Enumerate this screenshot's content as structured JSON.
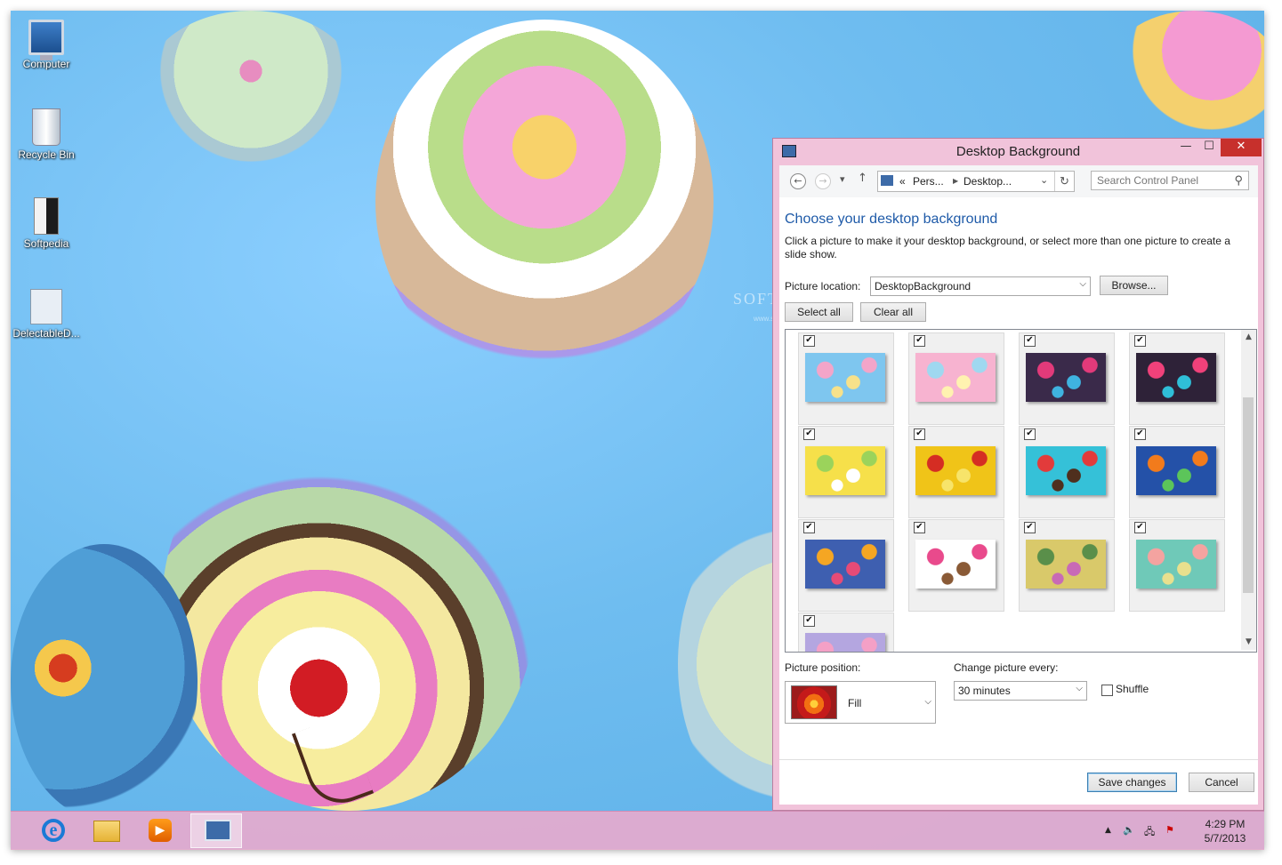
{
  "desktop": {
    "icons": [
      {
        "label": "Computer"
      },
      {
        "label": "Recycle Bin"
      },
      {
        "label": "Softpedia"
      },
      {
        "label": "DelectableD..."
      }
    ],
    "watermark": "SOFTPEDIA",
    "watermark_sub": "www.softpedia.com"
  },
  "window": {
    "title": "Desktop Background",
    "controls": {
      "minimize": "—",
      "maximize": "☐",
      "close": "✕"
    },
    "nav": {
      "breadcrumb_prefix": "«",
      "crumb1": "Pers...",
      "crumb2": "Desktop...",
      "search_placeholder": "Search Control Panel"
    },
    "heading": "Choose your desktop background",
    "description": "Click a picture to make it your desktop background, or select more than one picture to create a slide show.",
    "picture_location_label": "Picture location:",
    "picture_location_value": "DesktopBackground",
    "browse_label": "Browse...",
    "select_all_label": "Select all",
    "clear_all_label": "Clear all",
    "thumbnails": [
      {
        "checked": true,
        "colors": [
          "#7ec6ef",
          "#f3a5c9",
          "#f7e18a"
        ]
      },
      {
        "checked": true,
        "colors": [
          "#f7b3d0",
          "#9fd8f0",
          "#fff2b0"
        ]
      },
      {
        "checked": true,
        "colors": [
          "#3a2a4a",
          "#e23a7a",
          "#3fb3e0"
        ]
      },
      {
        "checked": true,
        "colors": [
          "#2e2238",
          "#f0417a",
          "#2fbfd8"
        ]
      },
      {
        "checked": true,
        "colors": [
          "#f6e04a",
          "#9bd35b",
          "#ffffff"
        ]
      },
      {
        "checked": true,
        "colors": [
          "#f0c418",
          "#d52d23",
          "#f7e46a"
        ]
      },
      {
        "checked": true,
        "colors": [
          "#35c1d8",
          "#e23b3b",
          "#4f2f1e"
        ]
      },
      {
        "checked": true,
        "colors": [
          "#2451a8",
          "#f27b1c",
          "#5cc55a"
        ]
      },
      {
        "checked": true,
        "colors": [
          "#3e5fb0",
          "#f5a623",
          "#e64b77"
        ]
      },
      {
        "checked": true,
        "colors": [
          "#ffffff",
          "#e94a8c",
          "#8a5a36"
        ]
      },
      {
        "checked": true,
        "colors": [
          "#d9c96a",
          "#5a8f4a",
          "#c86ab6"
        ]
      },
      {
        "checked": true,
        "colors": [
          "#6fc9b8",
          "#f4a3a0",
          "#e8e08e"
        ]
      },
      {
        "checked": true,
        "colors": [
          "#b4a6e0",
          "#f4a0c6",
          "#ffffff"
        ]
      }
    ],
    "picture_position_label": "Picture position:",
    "picture_position_value": "Fill",
    "change_picture_label": "Change picture every:",
    "change_picture_value": "30 minutes",
    "shuffle_label": "Shuffle",
    "shuffle_checked": false,
    "save_label": "Save changes",
    "cancel_label": "Cancel"
  },
  "taskbar": {
    "apps": [
      {
        "name": "internet-explorer",
        "active": false
      },
      {
        "name": "file-explorer",
        "active": false
      },
      {
        "name": "windows-media-player",
        "active": false
      },
      {
        "name": "control-panel",
        "active": true
      }
    ],
    "clock_time": "4:29 PM",
    "clock_date": "5/7/2013"
  }
}
